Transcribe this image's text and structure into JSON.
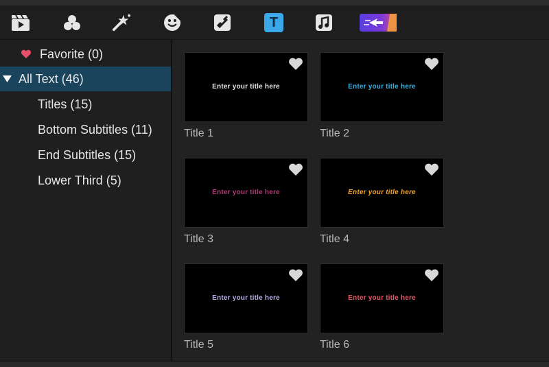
{
  "toolbar": {
    "icons": [
      "media-icon",
      "effects-icon",
      "magic-wand-icon",
      "sticker-icon",
      "transition-icon",
      "text-icon",
      "music-icon",
      "premium-promo-icon"
    ],
    "active_icon": "text-icon",
    "text_icon_glyph": "T",
    "active_color": "#3aa8e8"
  },
  "sidebar": {
    "items": [
      {
        "label": "Favorite (0)",
        "icon": "heart-icon"
      },
      {
        "label": "All Text (46)",
        "icon": "expanded-triangle-icon",
        "selected": true
      },
      {
        "label": "Titles (15)"
      },
      {
        "label": "Bottom Subtitles (11)"
      },
      {
        "label": "End Subtitles (15)"
      },
      {
        "label": "Lower Third (5)"
      }
    ],
    "selected_color": "#19445c",
    "heart_color": "#e8506a"
  },
  "cards": [
    {
      "label": "Title 1",
      "preview_text": "Enter your title here",
      "preview_color": "#e8e8e8"
    },
    {
      "label": "Title 2",
      "preview_text": "Enter your title here",
      "preview_color": "#3ab4e6"
    },
    {
      "label": "Title 3",
      "preview_text": "Enter your title here",
      "preview_color": "#b23a7a"
    },
    {
      "label": "Title 4",
      "preview_text": "Enter your title here",
      "preview_color": "#f2a52a"
    },
    {
      "label": "Title 5",
      "preview_text": "Enter your title here",
      "preview_color": "#b7b0e8"
    },
    {
      "label": "Title 6",
      "preview_text": "Enter your title here",
      "preview_color": "#e85a6a"
    }
  ]
}
